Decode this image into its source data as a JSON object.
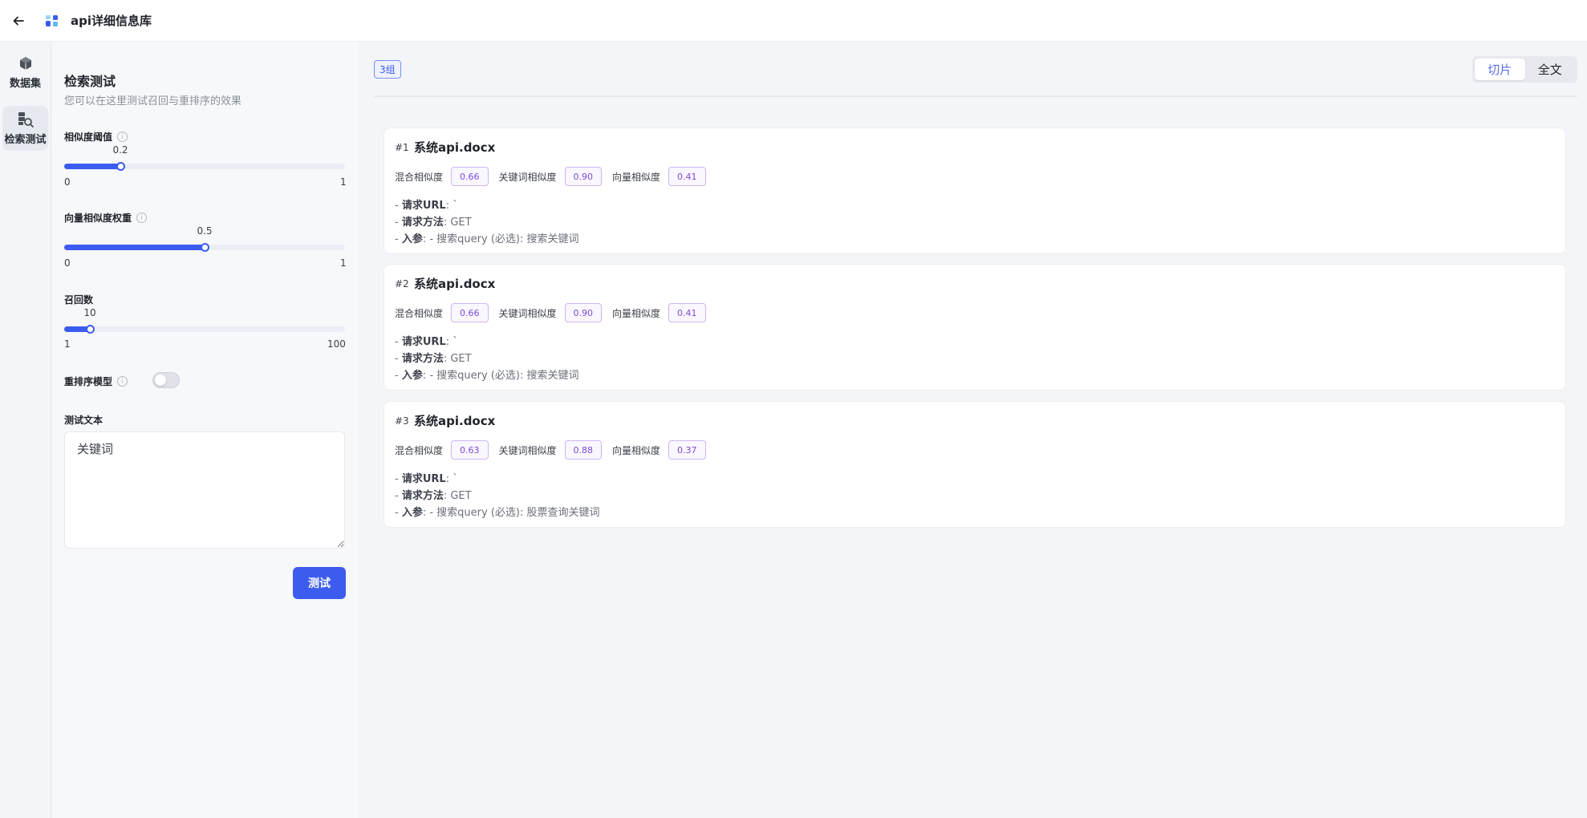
{
  "header": {
    "title": "api详细信息库"
  },
  "rail": {
    "items": [
      {
        "label": "数据集",
        "icon": "cube-icon",
        "active": false
      },
      {
        "label": "检索测试",
        "icon": "search-test-icon",
        "active": true
      }
    ]
  },
  "panel": {
    "title": "检索测试",
    "subtitle": "您可以在这里测试召回与重排序的效果",
    "similarity": {
      "label": "相似度阈值",
      "value": "0.2",
      "min": "0",
      "max": "1",
      "fraction": 0.2
    },
    "vector_weight": {
      "label": "向量相似度权重",
      "value": "0.5",
      "min": "0",
      "max": "1",
      "fraction": 0.5
    },
    "recall": {
      "label": "召回数",
      "value": "10",
      "min": "1",
      "max": "100",
      "fraction": 0.0909
    },
    "rerank": {
      "label": "重排序模型",
      "enabled": false
    },
    "test_text": {
      "label": "测试文本",
      "value": "关键词"
    },
    "test_button": "测试"
  },
  "results": {
    "group_badge": "3组",
    "segments": [
      {
        "label": "切片",
        "active": true
      },
      {
        "label": "全文",
        "active": false
      }
    ],
    "score_labels": {
      "mixed": "混合相似度",
      "keyword": "关键词相似度",
      "vector": "向量相似度"
    },
    "line_labels": {
      "url": "请求URL",
      "method": "请求方法",
      "params": "入参"
    },
    "cards": [
      {
        "index": "#1",
        "file": "系统api.docx",
        "mixed": "0.66",
        "keyword": "0.90",
        "vector": "0.41",
        "url_val": ": `",
        "method_val": ": GET",
        "params_val": ": - 搜索query (必选): 搜索关键词"
      },
      {
        "index": "#2",
        "file": "系统api.docx",
        "mixed": "0.66",
        "keyword": "0.90",
        "vector": "0.41",
        "url_val": ": `",
        "method_val": ": GET",
        "params_val": ": - 搜索query (必选): 搜索关键词"
      },
      {
        "index": "#3",
        "file": "系统api.docx",
        "mixed": "0.63",
        "keyword": "0.88",
        "vector": "0.37",
        "url_val": ": `",
        "method_val": ": GET",
        "params_val": ": - 搜索query (必选): 股票查询关键词"
      }
    ]
  },
  "colors": {
    "accent": "#3c5cf0",
    "score_text": "#7b4ad9",
    "score_border": "#cdb6f4"
  }
}
